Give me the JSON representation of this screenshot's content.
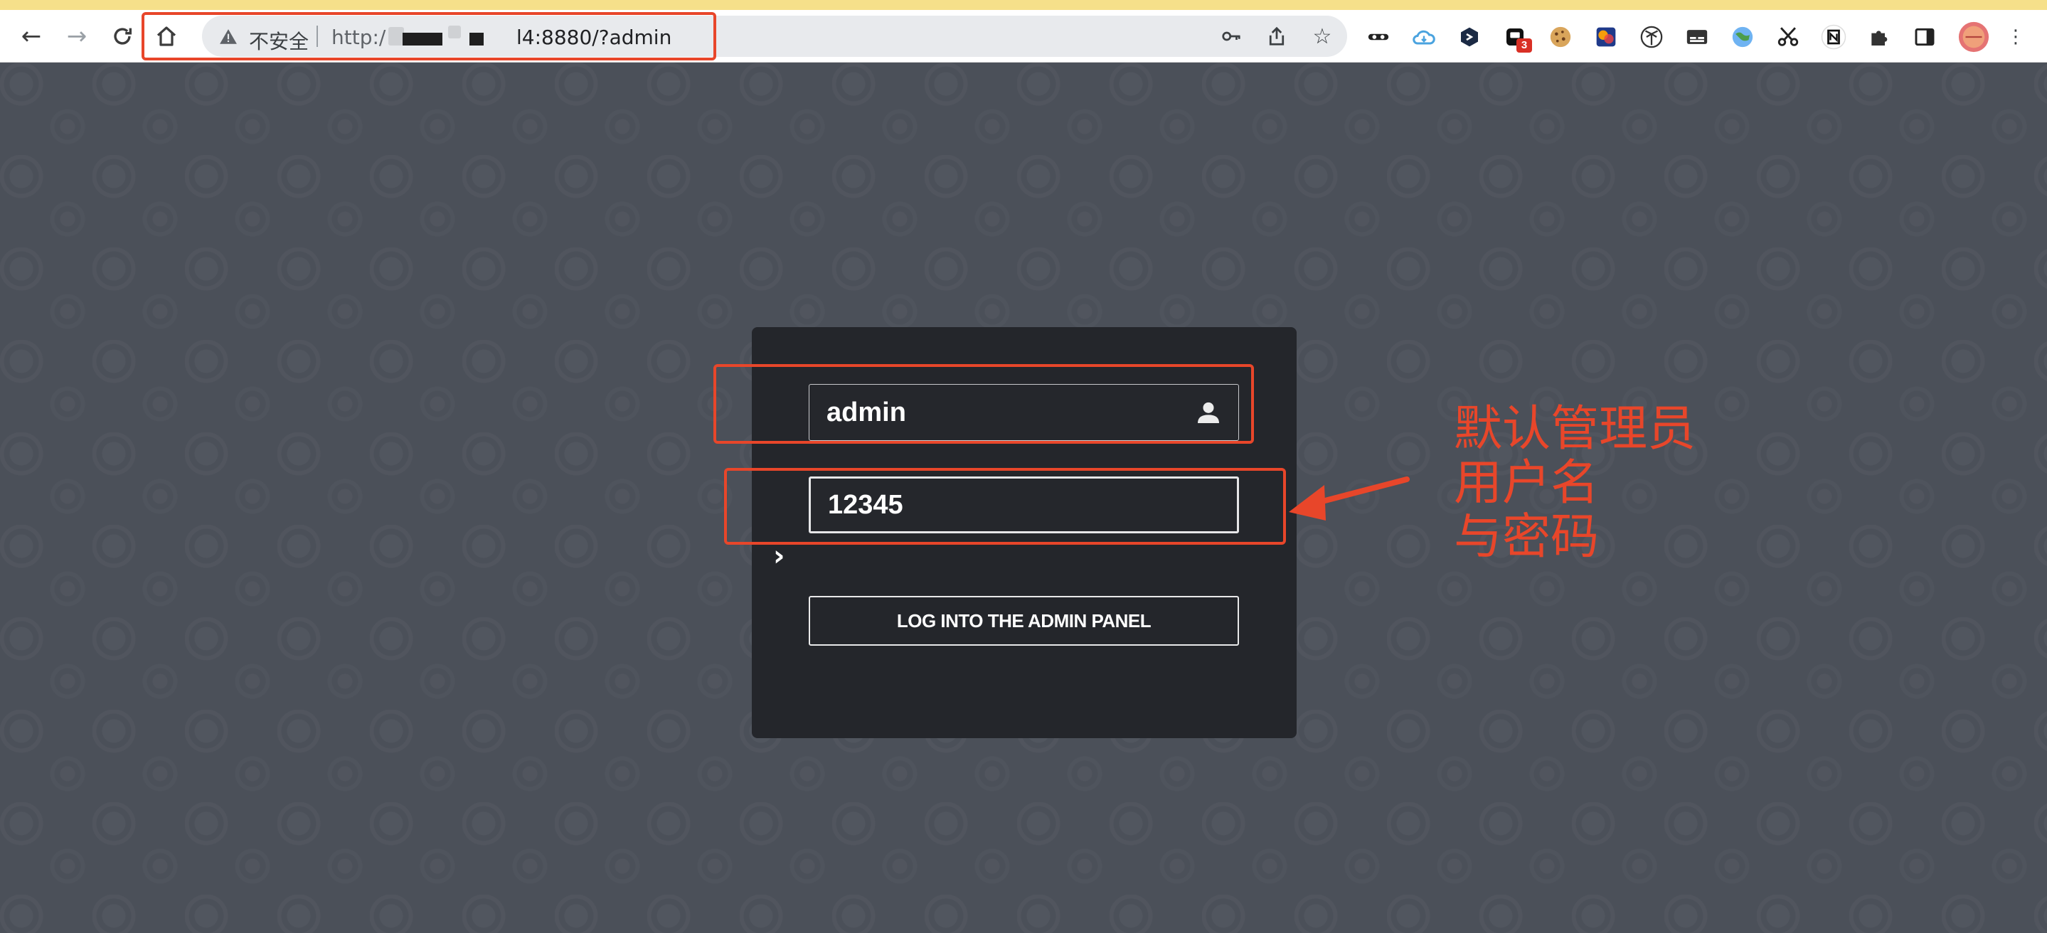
{
  "browser": {
    "security_label": "不安全",
    "url_scheme": "http:/",
    "url_visible_tail": "l4:8880/?admin",
    "extensions": [
      {
        "name": "incognito-mask-icon"
      },
      {
        "name": "cloud-icon"
      },
      {
        "name": "hexagon-icon"
      },
      {
        "name": "notifier-icon",
        "badge": "3"
      },
      {
        "name": "cookie-icon"
      },
      {
        "name": "colorful-square-icon"
      },
      {
        "name": "palm-icon"
      },
      {
        "name": "subtitles-icon"
      },
      {
        "name": "globe-icon"
      },
      {
        "name": "scissors-icon"
      },
      {
        "name": "notion-icon"
      },
      {
        "name": "puzzle-icon"
      },
      {
        "name": "sidepanel-icon"
      }
    ]
  },
  "login": {
    "username_value": "admin",
    "password_value": "12345",
    "button_label": "LOG INTO THE ADMIN PANEL"
  },
  "annotation": {
    "lines": [
      "默认管理员",
      "用户名",
      "与密码"
    ],
    "color": "#e8462a"
  },
  "colors": {
    "page_bg": "#4b5059",
    "panel_bg": "#24262b",
    "accent_annotation": "#e8462a"
  }
}
